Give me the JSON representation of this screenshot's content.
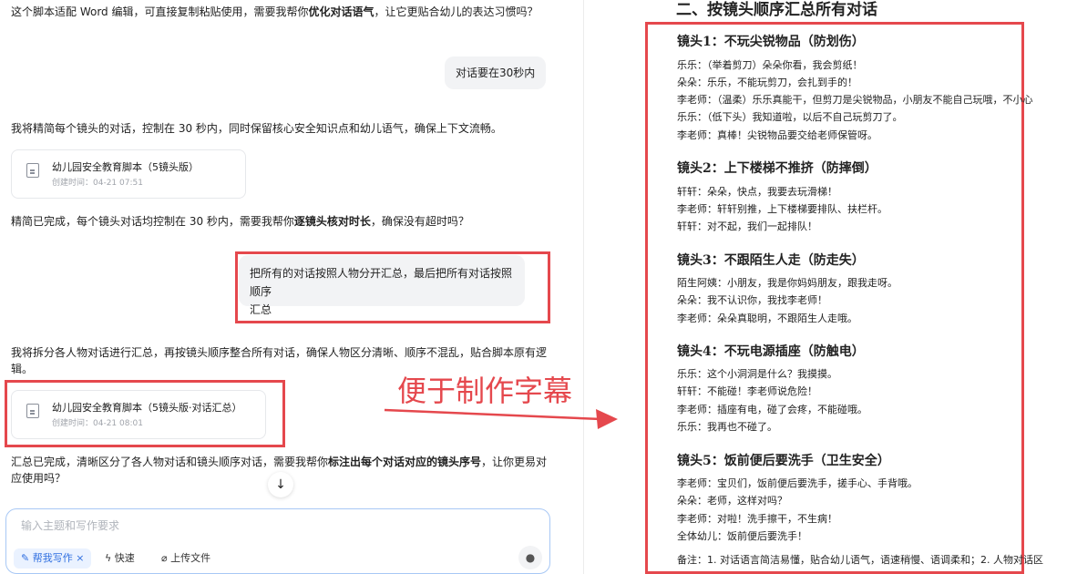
{
  "chat": {
    "msg1_pre": "这个脚本适配 Word 编辑，可直接复制粘贴使用，需要我帮你",
    "msg1_bold": "优化对话语气",
    "msg1_post": "，让它更贴合幼儿的表达习惯吗？",
    "user1": "对话要在30秒内",
    "msg2": "我将精简每个镜头的对话，控制在 30 秒内，同时保留核心安全知识点和幼儿语气，确保上下文流畅。",
    "file1": {
      "title": "幼儿园安全教育脚本（5镜头版）",
      "time": "创建时间：04-21 07:51"
    },
    "msg3_pre": "精简已完成，每个镜头对话均控制在 30 秒内，需要我帮你",
    "msg3_bold": "逐镜头核对时长",
    "msg3_post": "，确保没有超时吗？",
    "user2_line1": "把所有的对话按照人物分开汇总，最后把所有对话按照顺序",
    "user2_line2": "汇总",
    "msg4_line1": "我将拆分各人物对话进行汇总，再按镜头顺序整合所有对话，确保人物区分清晰、顺序不混乱，贴合脚本原有逻",
    "msg4_line2": "辑。",
    "file2": {
      "title": "幼儿园安全教育脚本（5镜头版·对话汇总）",
      "time": "创建时间：04-21 08:01"
    },
    "msg5_pre": "汇总已完成，清晰区分了各人物对话和镜头顺序对话，需要我帮你",
    "msg5_bold": "标注出每个对话对应的镜头序号",
    "msg5_post": "，让你更易对",
    "msg5_line2": "应使用吗？",
    "scroll_icon": "↓"
  },
  "composer": {
    "placeholder": "输入主题和写作要求",
    "chip_help": "帮我写作",
    "chip_help_close": "×",
    "chip_fast": "快速",
    "chip_upload": "上传文件",
    "mic_icon": "microphone-icon"
  },
  "annotation": {
    "text": "便于制作字幕",
    "color": "#e5484d"
  },
  "doc": {
    "heading": "二、按镜头顺序汇总所有对话",
    "shots": [
      {
        "title": "镜头1：不玩尖锐物品（防划伤）",
        "lines": [
          "乐乐：（举着剪刀）朵朵你看，我会剪纸！",
          "朵朵：乐乐，不能玩剪刀，会扎到手的！",
          "李老师：（温柔）乐乐真能干，但剪刀是尖锐物品，小朋友不能自己玩哦，不小心",
          "乐乐：（低下头）我知道啦，以后不自己玩剪刀了。",
          "李老师：真棒！尖锐物品要交给老师保管呀。"
        ]
      },
      {
        "title": "镜头2：上下楼梯不推挤（防摔倒）",
        "lines": [
          "轩轩：朵朵，快点，我要去玩滑梯！",
          "李老师：轩轩别推，上下楼梯要排队、扶栏杆。",
          "轩轩：对不起，我们一起排队！"
        ]
      },
      {
        "title": "镜头3：不跟陌生人走（防走失）",
        "lines": [
          "陌生阿姨：小朋友，我是你妈妈朋友，跟我走呀。",
          "朵朵：我不认识你，我找李老师！",
          "李老师：朵朵真聪明，不跟陌生人走哦。"
        ]
      },
      {
        "title": "镜头4：不玩电源插座（防触电）",
        "lines": [
          "乐乐：这个小洞洞是什么？我摸摸。",
          "轩轩：不能碰！李老师说危险！",
          "李老师：插座有电，碰了会疼，不能碰哦。",
          "乐乐：我再也不碰了。"
        ]
      },
      {
        "title": "镜头5：饭前便后要洗手（卫生安全）",
        "lines": [
          "李老师：宝贝们，饭前便后要洗手，搓手心、手背哦。",
          "朵朵：老师，这样对吗？",
          "李老师：对啦！洗手擦干，不生病！",
          "全体幼儿：饭前便后要洗手！"
        ]
      }
    ],
    "note": "备注：1. 对话语言简洁易懂，贴合幼儿语气，语速稍慢、语调柔和；2. 人物对话区"
  }
}
